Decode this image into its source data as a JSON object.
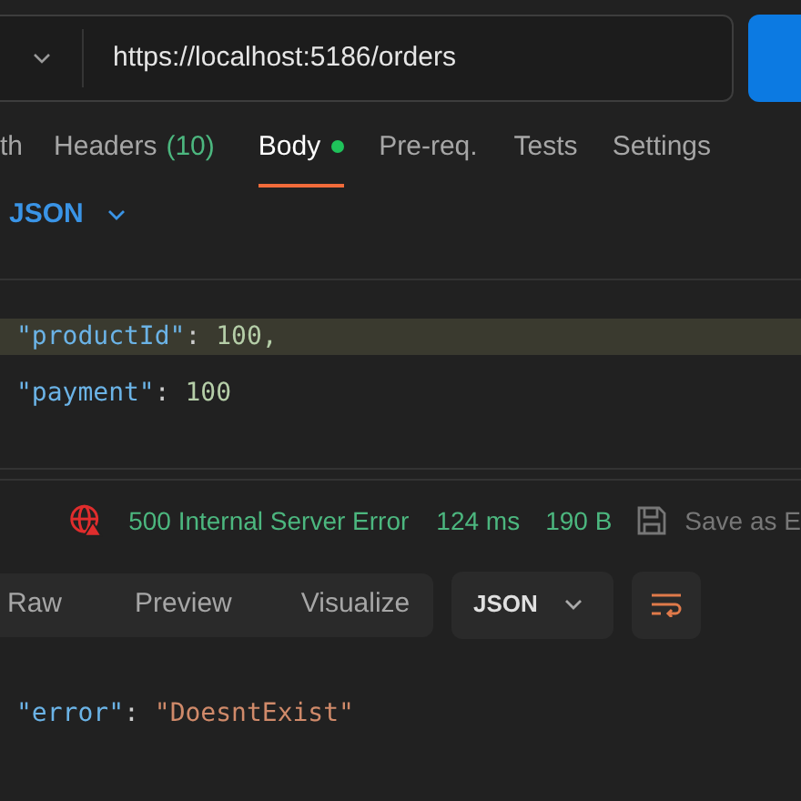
{
  "url_bar": {
    "url": "https://localhost:5186/orders"
  },
  "request_tabs": [
    {
      "label": "th",
      "selected": false
    },
    {
      "label": "Headers",
      "count": "(10)",
      "selected": false
    },
    {
      "label": "Body",
      "selected": true,
      "has_content": true
    },
    {
      "label": "Pre-req.",
      "selected": false
    },
    {
      "label": "Tests",
      "selected": false
    },
    {
      "label": "Settings",
      "selected": false
    }
  ],
  "body_format": {
    "label": "JSON"
  },
  "request_body": {
    "lines": [
      {
        "highlighted": true,
        "tokens": [
          {
            "kind": "key",
            "text": "\"productId\""
          },
          {
            "kind": "punct",
            "text": ":"
          },
          {
            "kind": "number",
            "text": "100,"
          }
        ]
      },
      {
        "highlighted": false,
        "tokens": [
          {
            "kind": "key",
            "text": "\"payment\""
          },
          {
            "kind": "punct",
            "text": ":"
          },
          {
            "kind": "number",
            "text": "100"
          }
        ]
      }
    ]
  },
  "response_status": {
    "status": "500 Internal Server Error",
    "time": "124 ms",
    "size": "190 B",
    "save_label": "Save as E"
  },
  "response_tabs": [
    {
      "label": "Raw",
      "selected": false
    },
    {
      "label": "Preview",
      "selected": false
    },
    {
      "label": "Visualize",
      "selected": false
    }
  ],
  "response_format": {
    "label": "JSON"
  },
  "response_body": {
    "lines": [
      {
        "highlighted": false,
        "tokens": [
          {
            "kind": "key",
            "text": "\"error\""
          },
          {
            "kind": "punct",
            "text": ":"
          },
          {
            "kind": "string",
            "text": "\"DoesntExist\""
          }
        ]
      }
    ]
  }
}
